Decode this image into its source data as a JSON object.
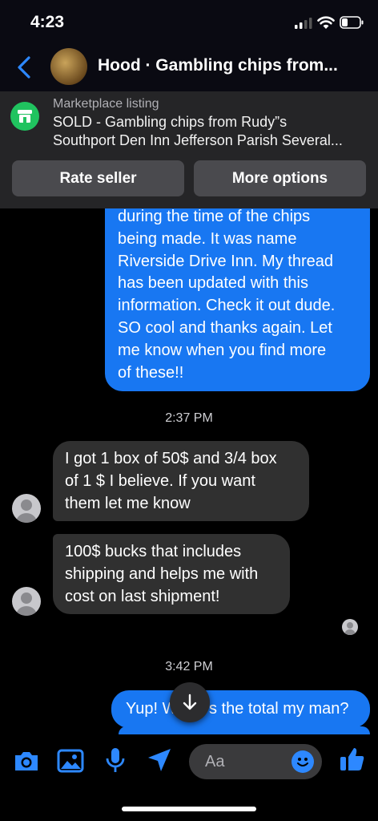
{
  "status": {
    "time": "4:23"
  },
  "header": {
    "title": "Hood · Gambling chips from..."
  },
  "listing": {
    "label": "Marketplace listing",
    "title_line1": "SOLD - Gambling chips from Rudy”s",
    "title_line2": "Southport Den  Inn Jefferson Parish Several...",
    "rate_seller": "Rate seller",
    "more_options": "More options"
  },
  "messages": {
    "m1_lines": [
      "during the time of the chips",
      "being made. It was name",
      "Riverside Drive Inn. My thread",
      "has been updated with this",
      "information. Check it out dude.",
      "SO cool and thanks again. Let",
      "me know when you find more",
      "of these!!"
    ],
    "ts1": "2:37 PM",
    "m2_lines": [
      "I got 1 box of 50$ and 3/4 box",
      "of 1 $ I believe. If you want",
      "them let me know"
    ],
    "m3_lines": [
      "100$ bucks that includes",
      "shipping and helps me with",
      "cost on last shipment!"
    ],
    "ts2": "3:42 PM",
    "m4_left": "Yup! W",
    "m4_right": "s the total my man?"
  },
  "composer": {
    "placeholder": "Aa"
  },
  "colors": {
    "accent": "#1877f2",
    "incoming": "#303030",
    "listing_green": "#20c35f"
  },
  "icons": [
    "chevron-left-icon",
    "shop-icon",
    "camera-icon",
    "photo-icon",
    "microphone-icon",
    "send-location-icon",
    "emoji-icon",
    "thumbs-up-icon",
    "scroll-down-arrow-icon",
    "wifi-icon",
    "signal-icon",
    "battery-icon"
  ]
}
